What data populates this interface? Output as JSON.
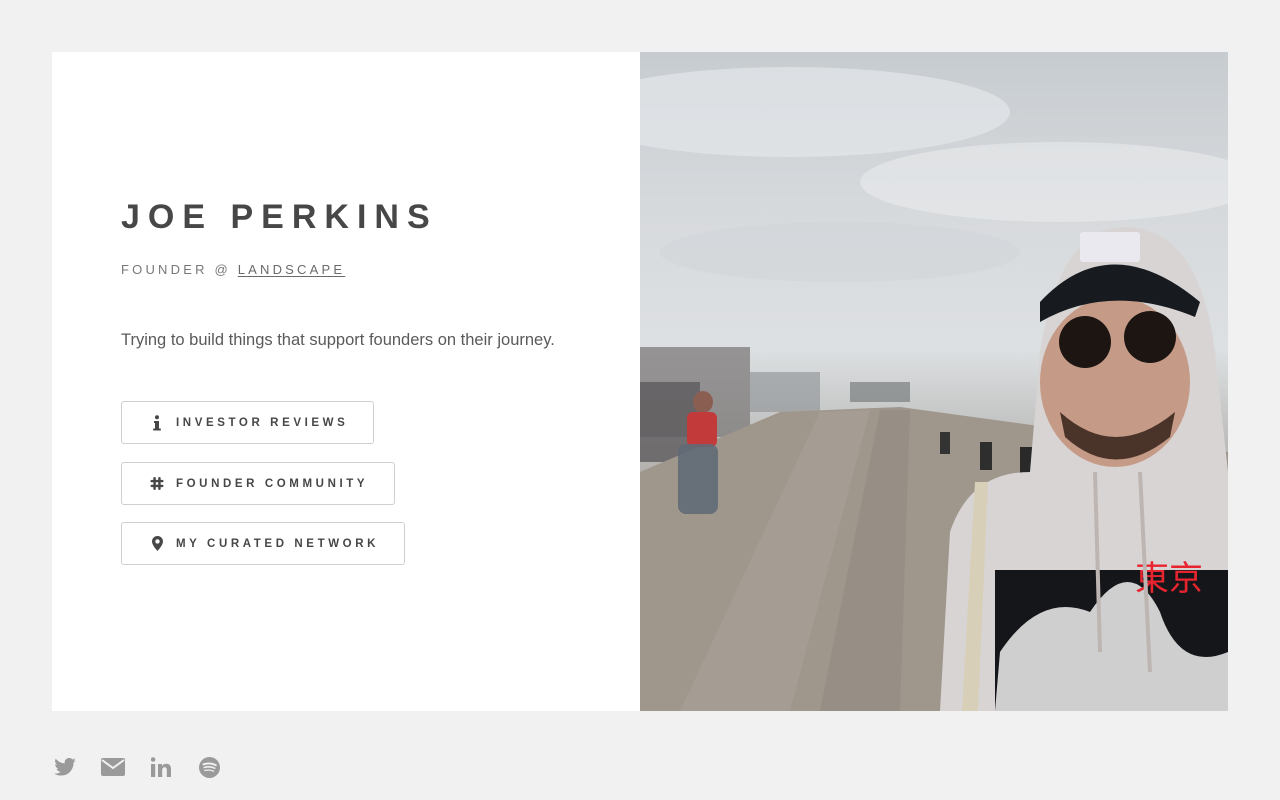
{
  "profile": {
    "name": "JOE PERKINS",
    "role_prefix": "FOUNDER @",
    "company_link": "LANDSCAPE",
    "tagline": "Trying to build things that support founders on their journey."
  },
  "buttons": [
    {
      "label": "INVESTOR REVIEWS",
      "icon": "info-icon"
    },
    {
      "label": "FOUNDER COMMUNITY",
      "icon": "slack-icon"
    },
    {
      "label": "MY CURATED NETWORK",
      "icon": "map-marker-icon"
    }
  ],
  "photo": {
    "description_icon": "profile-photo",
    "shirt_text": "東京"
  },
  "social": [
    {
      "icon": "twitter-icon"
    },
    {
      "icon": "envelope-icon"
    },
    {
      "icon": "linkedin-icon"
    },
    {
      "icon": "spotify-icon"
    }
  ],
  "colors": {
    "background": "#f1f1f1",
    "card": "#ffffff",
    "text": "#474747",
    "muted": "#9a9a9a",
    "accent_red": "#e8252f"
  }
}
